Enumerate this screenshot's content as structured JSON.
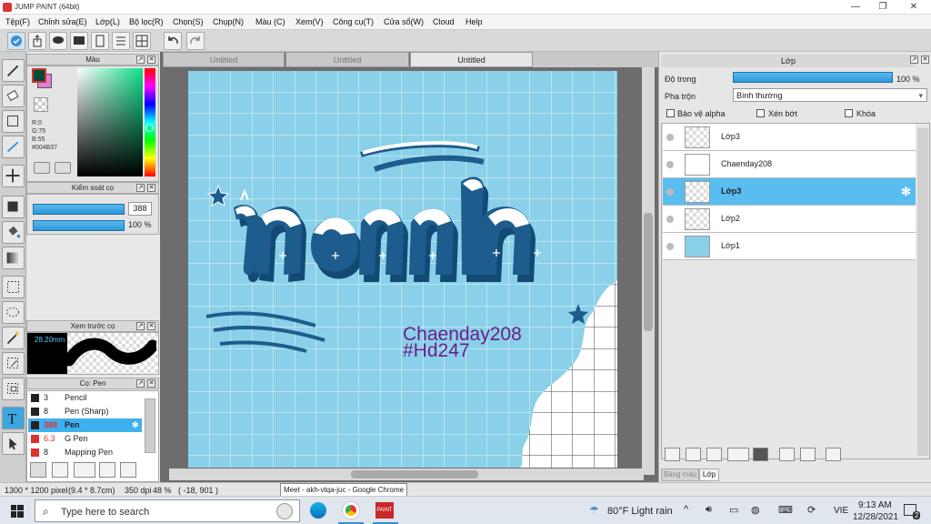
{
  "window": {
    "title": "JUMP PAINT (64bit)"
  },
  "menu": [
    "Tệp(F)",
    "Chỉnh sửa(E)",
    "Lớp(L)",
    "Bộ lọc(R)",
    "Chọn(S)",
    "Chụp(N)",
    "Màu (C)",
    "Xem(V)",
    "Công cụ(T)",
    "Cửa sổ(W)",
    "Cloud",
    "Help"
  ],
  "color_panel": {
    "title": "Màu",
    "r": "R:0",
    "g": "G:75",
    "b": "B:55",
    "hex": "#004B37",
    "main_color": "#004B37",
    "sub_color": "#e080d8"
  },
  "brush_control": {
    "title": "Kiểm soát cọ",
    "size": "388",
    "opacity": "100 %"
  },
  "brush_preview": {
    "title": "Xem trước cọ",
    "size_label": "28.20mm"
  },
  "brush_list": {
    "title": "Cọ: Pen",
    "items": [
      {
        "size": "3",
        "name": "Pencil",
        "color": "#222222"
      },
      {
        "size": "8",
        "name": "Pen (Sharp)",
        "color": "#222222"
      },
      {
        "size": "388",
        "name": "Pen",
        "color": "#222222",
        "selected": true
      },
      {
        "size": "6.3",
        "name": "G Pen",
        "color": "#e03030"
      },
      {
        "size": "8",
        "name": "Mapping Pen",
        "color": "#e03030"
      }
    ]
  },
  "tabs": [
    "Untitled",
    "Untitled",
    "Untitled"
  ],
  "artwork": {
    "main_word": "nành",
    "text1": "Chaenday208",
    "text2": "#Hd247",
    "text_color": "#6b1e8a",
    "letter_color": "#1d5c8c",
    "bg_color": "#8ad0e8"
  },
  "layer_panel": {
    "title": "Lớp",
    "opacity_label": "Độ trong",
    "opacity_value": "100 %",
    "blend_label": "Pha trộn",
    "blend_value": "Bình thường",
    "protect_alpha": "Bảo vệ alpha",
    "clipping": "Xén bớt",
    "lock": "Khóa",
    "layers": [
      {
        "name": "Lớp3",
        "selected": false
      },
      {
        "name": "Chaenday208",
        "selected": false
      },
      {
        "name": "Lớp3",
        "selected": true
      },
      {
        "name": "Lớp2",
        "selected": false
      },
      {
        "name": "Lớp1",
        "selected": false
      }
    ],
    "bottom_tabs": [
      "Bảng màu",
      "Lớp"
    ]
  },
  "status": {
    "pixels": "1300 * 1200 pixel",
    "dims": "(9.4 * 8.7cm)",
    "dpi": "350 dpi",
    "zoom": "48 %",
    "coords": "( -18, 901 )"
  },
  "tooltip": "Meet - akh-vtqa-juc - Google Chrome",
  "taskbar": {
    "search_placeholder": "Type here to search",
    "weather": "80°F  Light rain",
    "lang": "VIE",
    "time": "9:13 AM",
    "date": "12/28/2021",
    "notif_count": "2"
  }
}
